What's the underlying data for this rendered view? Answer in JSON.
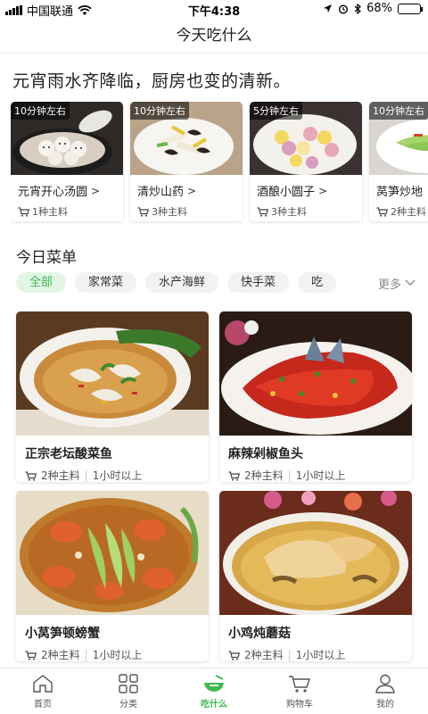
{
  "status_bar": {
    "carrier": "中国联通",
    "time": "下午4:38",
    "battery": "68%",
    "battery_level": 0.68
  },
  "nav": {
    "title": "今天吃什么"
  },
  "hero": {
    "headline": "元宵雨水齐降临，厨房也变的清新。"
  },
  "carousel": [
    {
      "time": "10分钟左右",
      "title": "元宵开心汤圆",
      "meta": "1种主料",
      "image": "tangyuan-bowl"
    },
    {
      "time": "10分钟左右",
      "title": "清炒山药",
      "meta": "3种主料",
      "image": "stir-fried-yam"
    },
    {
      "time": "5分钟左右",
      "title": "酒酿小圆子",
      "meta": "3种主料",
      "image": "rice-balls"
    },
    {
      "time": "10分钟左右",
      "title": "莴笋炒地",
      "meta": "2种主料",
      "image": "lettuce-stem"
    }
  ],
  "menu": {
    "title": "今日菜单",
    "chips": [
      "全部",
      "家常菜",
      "水产海鲜",
      "快手菜",
      "吃"
    ],
    "active_chip": "全部",
    "more": "更多"
  },
  "recipes": [
    {
      "title": "正宗老坛酸菜鱼",
      "ingredients": "2种主料",
      "duration": "1小时以上",
      "image": "pickled-fish"
    },
    {
      "title": "麻辣剁椒鱼头",
      "ingredients": "2种主料",
      "duration": "1小时以上",
      "image": "chili-fish-head"
    },
    {
      "title": "小莴笋顿螃蟹",
      "ingredients": "2种主料",
      "duration": "1小时以上",
      "image": "crab-lettuce"
    },
    {
      "title": "小鸡炖蘑菇",
      "ingredients": "2种主料",
      "duration": "1小时以上",
      "image": "chicken-mushroom"
    }
  ],
  "tabs": [
    {
      "label": "首页",
      "icon": "home-icon"
    },
    {
      "label": "分类",
      "icon": "grid-icon"
    },
    {
      "label": "吃什么",
      "icon": "bowl-icon",
      "active": true
    },
    {
      "label": "购物车",
      "icon": "cart-icon"
    },
    {
      "label": "我的",
      "icon": "user-icon"
    }
  ],
  "colors": {
    "accent": "#3db94f",
    "chip_active_bg": "#e3f6e6"
  }
}
